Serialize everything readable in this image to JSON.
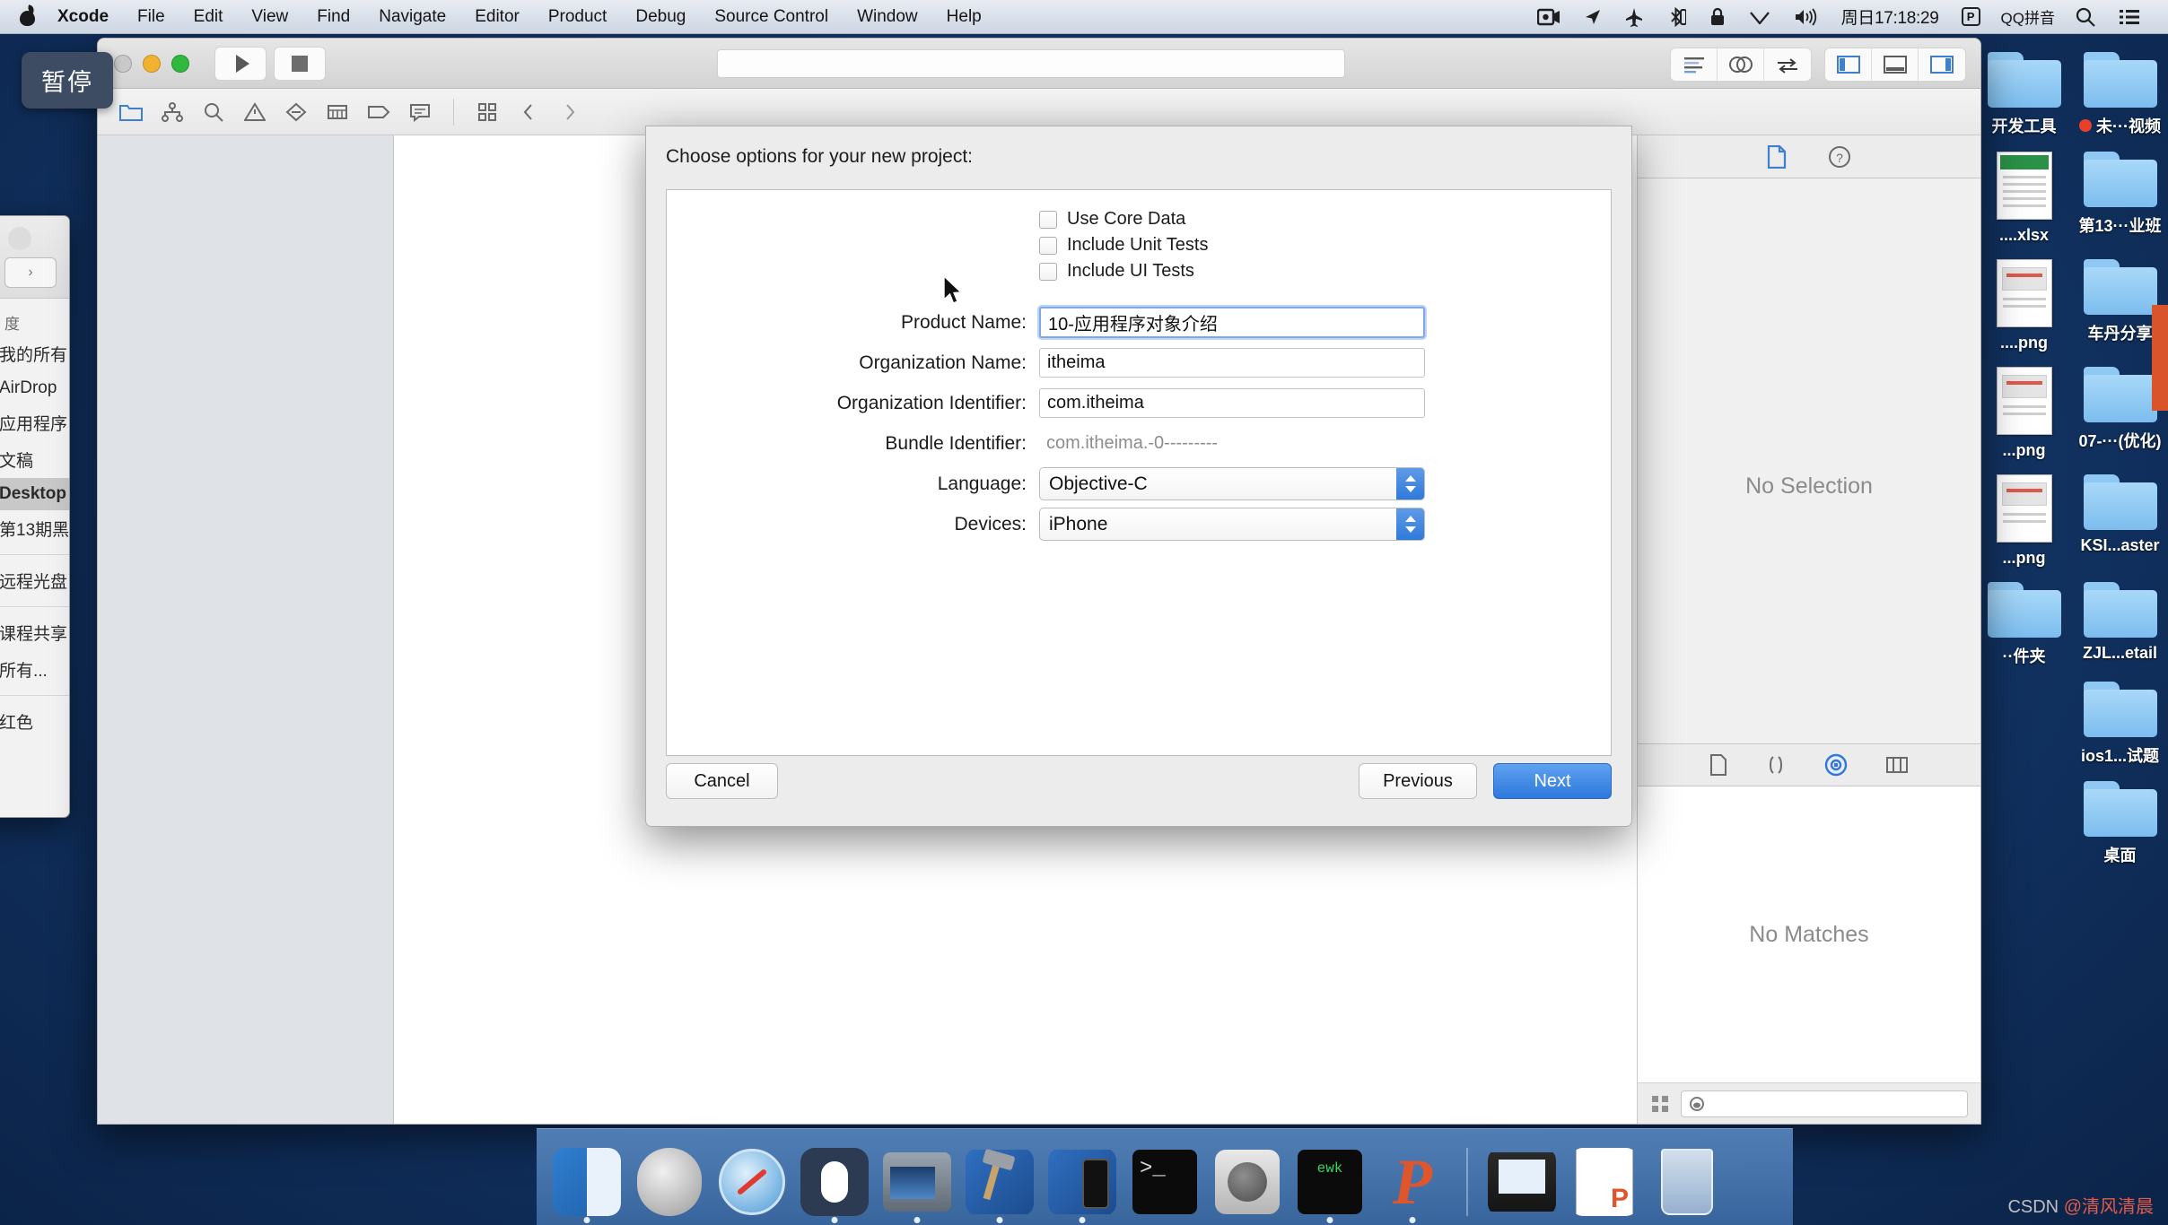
{
  "menubar": {
    "apple_icon": "apple-logo",
    "items": [
      {
        "label": "Xcode",
        "bold": true
      },
      {
        "label": "File",
        "bold": false
      },
      {
        "label": "Edit",
        "bold": false
      },
      {
        "label": "View",
        "bold": false
      },
      {
        "label": "Find",
        "bold": false
      },
      {
        "label": "Navigate",
        "bold": false
      },
      {
        "label": "Editor",
        "bold": false
      },
      {
        "label": "Product",
        "bold": false
      },
      {
        "label": "Debug",
        "bold": false
      },
      {
        "label": "Source Control",
        "bold": false
      },
      {
        "label": "Window",
        "bold": false
      },
      {
        "label": "Help",
        "bold": false
      }
    ],
    "status_icons": [
      "screen-record-icon",
      "location-arrow-icon",
      "airplane-mode-icon",
      "bluetooth-icon",
      "lock-icon",
      "wifi-icon",
      "volume-icon"
    ],
    "clock": "周日17:18:29",
    "ime_key": "P",
    "ime_label": "QQ拼音",
    "search_icon": "search-icon",
    "notification_icon": "notification-center-icon"
  },
  "pause_badge": {
    "label": "暂停"
  },
  "finder": {
    "sidebar_header": "度",
    "items": [
      {
        "label": "我的所有",
        "selected": false
      },
      {
        "label": "AirDrop",
        "selected": false
      },
      {
        "label": "应用程序",
        "selected": false
      },
      {
        "label": "文稿",
        "selected": false
      },
      {
        "label": "Desktop",
        "selected": true
      },
      {
        "label": "第13期黑",
        "selected": false
      },
      {
        "label": "远程光盘",
        "selected": false
      },
      {
        "label": "课程共享",
        "selected": false
      },
      {
        "label": "所有...",
        "selected": false
      },
      {
        "label": "红色",
        "selected": false
      }
    ]
  },
  "xcode": {
    "traffic_lights": [
      "close-button",
      "minimize-button",
      "zoom-button"
    ],
    "run_icon": "run-play-icon",
    "stop_icon": "stop-square-icon",
    "toolbar_icons": [
      "folder-navigator-icon",
      "source-control-icon",
      "search-navigator-icon",
      "issue-warning-icon",
      "test-navigator-icon",
      "debug-navigator-icon",
      "breakpoint-navigator-icon",
      "report-navigator-icon"
    ],
    "jump_icons": [
      "grid-icon",
      "back-chevron-icon",
      "forward-chevron-icon"
    ],
    "editor_mode_icons": [
      "standard-editor-icon",
      "assistant-editor-icon",
      "version-editor-icon"
    ],
    "panel_toggle_icons": [
      "toggle-navigator-icon",
      "toggle-debug-area-icon",
      "toggle-inspector-icon"
    ],
    "inspector": {
      "tabs": [
        "file-inspector-icon",
        "quick-help-icon"
      ],
      "empty_text": "No Selection",
      "library_tabs": [
        "file-template-library-icon",
        "code-snippet-library-icon",
        "object-library-icon",
        "media-library-icon"
      ],
      "library_empty_text": "No Matches",
      "library_grid_icon": "grid-view-icon",
      "library_search_icon": "search-icon",
      "library_search_value": ""
    }
  },
  "sheet": {
    "title": "Choose options for your new project:",
    "fields": [
      {
        "label": "Product Name:",
        "value": "10-应用程序对象介绍",
        "type": "text",
        "focused": true
      },
      {
        "label": "Organization Name:",
        "value": "itheima",
        "type": "text",
        "focused": false
      },
      {
        "label": "Organization Identifier:",
        "value": "com.itheima",
        "type": "text",
        "focused": false
      },
      {
        "label": "Bundle Identifier:",
        "value": "com.itheima.-0---------",
        "type": "readonly",
        "focused": false
      },
      {
        "label": "Language:",
        "value": "Objective-C",
        "type": "popup",
        "focused": false
      },
      {
        "label": "Devices:",
        "value": "iPhone",
        "type": "popup",
        "focused": false
      }
    ],
    "checkboxes": [
      {
        "label": "Use Core Data",
        "checked": false
      },
      {
        "label": "Include Unit Tests",
        "checked": false
      },
      {
        "label": "Include UI Tests",
        "checked": false
      }
    ],
    "buttons": {
      "cancel": "Cancel",
      "previous": "Previous",
      "next": "Next"
    },
    "accent_color": "#2f78dd"
  },
  "desktop_icons": [
    {
      "label": "开发工具",
      "type": "folder",
      "badge": false
    },
    {
      "label": "未···视频",
      "type": "folder",
      "badge": true
    },
    {
      "label": "....xlsx",
      "type": "xlsx",
      "badge": false
    },
    {
      "label": "第13···业班",
      "type": "folder",
      "badge": false
    },
    {
      "label": "....png",
      "type": "png",
      "badge": false
    },
    {
      "label": "车丹分享",
      "type": "folder",
      "badge": false
    },
    {
      "label": "...png",
      "type": "png",
      "badge": false
    },
    {
      "label": "07-···(优化)",
      "type": "folder",
      "badge": false
    },
    {
      "label": "...png",
      "type": "png",
      "badge": false
    },
    {
      "label": "KSI...aster",
      "type": "folder",
      "badge": false
    },
    {
      "label": "··件夹",
      "type": "folder",
      "badge": false
    },
    {
      "label": "ZJL...etail",
      "type": "folder",
      "badge": false
    },
    {
      "label": "",
      "type": "blank",
      "badge": false
    },
    {
      "label": "ios1...试题",
      "type": "folder",
      "badge": false
    },
    {
      "label": "",
      "type": "blank",
      "badge": false
    },
    {
      "label": "桌面",
      "type": "folder",
      "badge": false
    }
  ],
  "dock": {
    "items": [
      {
        "name": "Finder",
        "icon": "finder-icon",
        "running": true
      },
      {
        "name": "Launchpad",
        "icon": "launchpad-icon",
        "running": false
      },
      {
        "name": "Safari",
        "icon": "safari-icon",
        "running": false
      },
      {
        "name": "Mouse Utility",
        "icon": "mouse-icon",
        "running": true
      },
      {
        "name": "QuickTime Player",
        "icon": "quicktime-icon",
        "running": true
      },
      {
        "name": "Xcode",
        "icon": "xcode-icon",
        "running": true
      },
      {
        "name": "Simulator",
        "icon": "simulator-icon",
        "running": true
      },
      {
        "name": "Terminal",
        "icon": "terminal-icon",
        "running": false
      },
      {
        "name": "System Preferences",
        "icon": "system-preferences-icon",
        "running": false
      },
      {
        "name": "EditWith",
        "icon": "editor-icon",
        "running": true
      },
      {
        "name": "Preview-P",
        "icon": "p-app-icon",
        "running": true
      }
    ],
    "minimized": [
      {
        "name": "Screen Window",
        "icon": "minimized-screen-icon"
      },
      {
        "name": "Document",
        "icon": "minimized-document-icon"
      }
    ],
    "trash": {
      "name": "Trash",
      "icon": "trash-icon"
    }
  },
  "watermark": {
    "prefix": "CSDN ",
    "handle": "@清风清晨"
  }
}
